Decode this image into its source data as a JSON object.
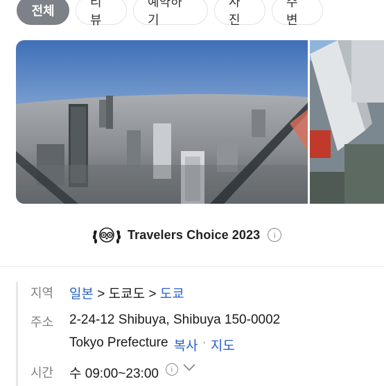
{
  "tabs": [
    {
      "label": "전체",
      "active": true
    },
    {
      "label": "리뷰",
      "active": false
    },
    {
      "label": "예약하기",
      "active": false
    },
    {
      "label": "사진",
      "active": false
    },
    {
      "label": "주변",
      "active": false
    }
  ],
  "award": {
    "logo": "tripadvisor-owl-laurel-icon",
    "text": "Travelers Choice 2023",
    "info": "i"
  },
  "details": {
    "region_label": "지역",
    "region": [
      "일본",
      "도쿄도",
      "도쿄"
    ],
    "region_sep": ">",
    "address_label": "주소",
    "address_line1": "2-24-12 Shibuya, Shibuya 150-0002",
    "address_line2": "Tokyo Prefecture",
    "copy_link": "복사",
    "dot": "·",
    "map_link": "지도",
    "hours_label": "시간",
    "hours_value": "수 09:00~23:00",
    "hours_info": "i"
  },
  "colors": {
    "active_tab": "#7d8188",
    "link": "#2a62c9",
    "label": "#808080"
  }
}
